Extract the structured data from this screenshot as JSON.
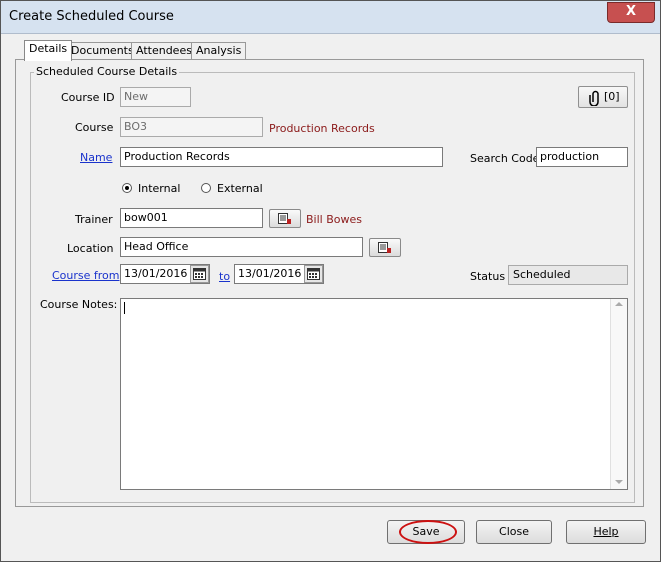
{
  "window": {
    "title": "Create Scheduled Course",
    "close_glyph": "X"
  },
  "tabs": [
    {
      "label": "Details",
      "active": true
    },
    {
      "label": "Documents",
      "active": false
    },
    {
      "label": "Attendees",
      "active": false
    },
    {
      "label": "Analysis",
      "active": false
    }
  ],
  "group": {
    "label": "Scheduled Course Details"
  },
  "form": {
    "course_id_label": "Course ID",
    "course_id_value": "New",
    "course_label": "Course",
    "course_value": "BO3",
    "course_desc": "Production Records",
    "name_label": "Name",
    "name_value": "Production Records",
    "search_code_label": "Search Code",
    "search_code_value": "production",
    "internal_label": "Internal",
    "external_label": "External",
    "selected_type": "Internal",
    "trainer_label": "Trainer",
    "trainer_value": "bow001",
    "trainer_name": "Bill Bowes",
    "location_label": "Location",
    "location_value": "Head Office",
    "course_from_label": "Course from",
    "course_from_value": "13/01/2016",
    "to_label": "to",
    "course_to_value": "13/01/2016",
    "status_label": "Status",
    "status_value": "Scheduled",
    "notes_label": "Course Notes:",
    "notes_value": "",
    "attachment_count": "[0]"
  },
  "footer": {
    "save_label": "Save",
    "close_label": "Close",
    "help_label": "Help"
  },
  "colors": {
    "accent_red": "#8b1a1a",
    "link_blue": "#1a33cc",
    "highlight_ring": "#cc1111"
  },
  "icons": [
    "close-icon",
    "paperclip-icon",
    "lookup-icon",
    "calendar-icon",
    "radio-selected-icon",
    "radio-unselected-icon",
    "scroll-up-icon",
    "scroll-down-icon"
  ]
}
